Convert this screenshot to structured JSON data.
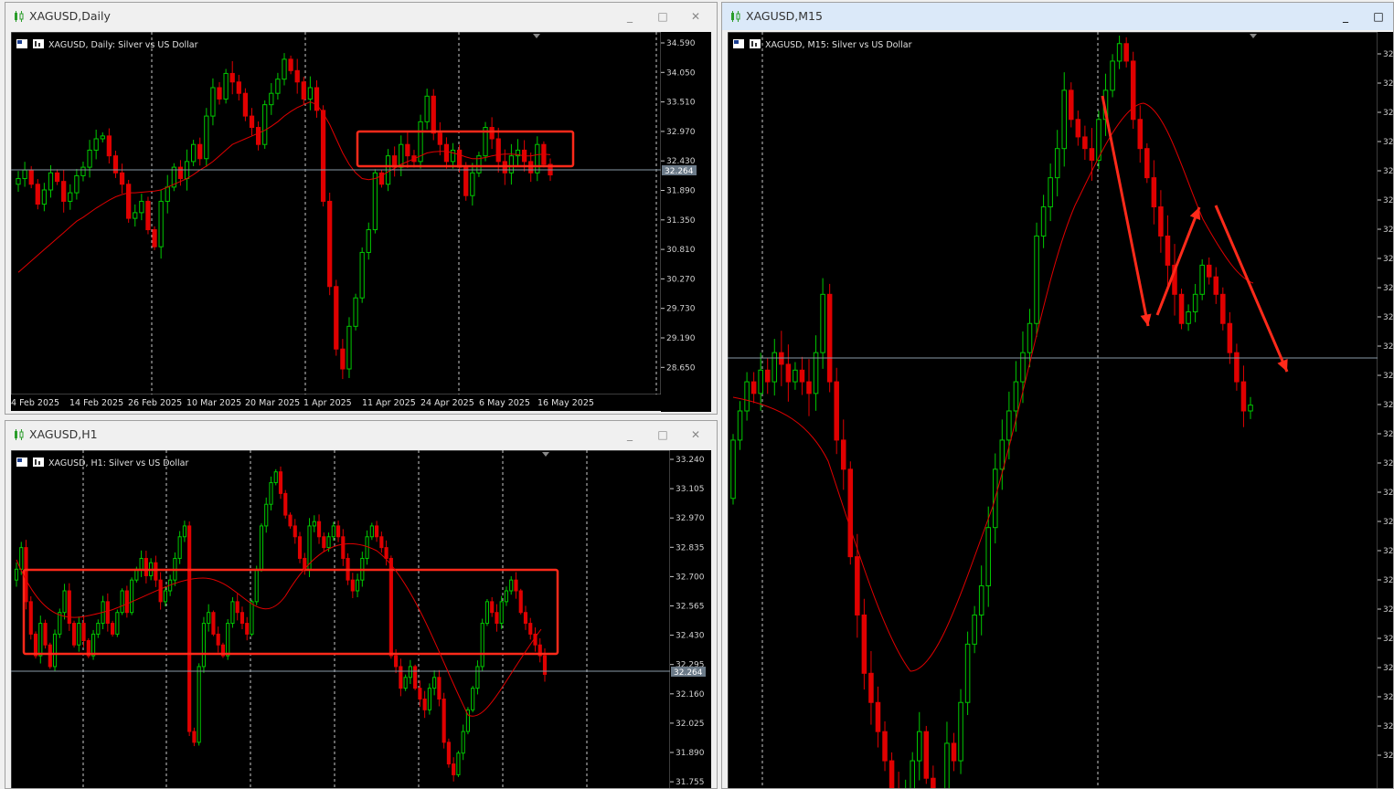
{
  "windows": {
    "daily": {
      "title": "XAGUSD,Daily",
      "header": "XAGUSD, Daily:  Silver vs US Dollar",
      "price_ticks": [
        "34.590",
        "34.050",
        "33.510",
        "32.970",
        "32.430",
        "31.890",
        "31.350",
        "30.810",
        "30.270",
        "29.730",
        "29.190",
        "28.650"
      ],
      "date_ticks": [
        "4 Feb 2025",
        "14 Feb 2025",
        "26 Feb 2025",
        "10 Mar 2025",
        "20 Mar 2025",
        "1 Apr 2025",
        "11 Apr 2025",
        "24 Apr 2025",
        "6 May 2025",
        "16 May 2025"
      ],
      "current_price": "32.264"
    },
    "h1": {
      "title": "XAGUSD,H1",
      "header": "XAGUSD, H1:  Silver vs US Dollar",
      "price_ticks": [
        "33.240",
        "33.105",
        "32.970",
        "32.835",
        "32.700",
        "32.565",
        "32.430",
        "32.295",
        "32.160",
        "32.025",
        "31.890",
        "31.755"
      ],
      "current_price": "32.264"
    },
    "m15": {
      "title": "XAGUSD,M15",
      "header": "XAGUSD, M15:  Silver vs US Dollar",
      "price_ticks": [
        "32",
        "32",
        "32",
        "32",
        "32",
        "32",
        "32",
        "32",
        "32",
        "32",
        "32",
        "32",
        "32",
        "32",
        "32",
        "32",
        "32",
        "32",
        "32",
        "32",
        "32",
        "32",
        "32",
        "32",
        "32"
      ],
      "current_price": "32"
    }
  },
  "colors": {
    "bull": "#00c800",
    "bear": "#e00000",
    "ma": "#e00000",
    "grid": "#c8c8c8",
    "annotation": "#ff2a1a",
    "price_line": "#8a9aa8"
  },
  "chart_data": [
    {
      "type": "candlestick",
      "symbol": "XAGUSD",
      "timeframe": "Daily",
      "ylim": [
        28.4,
        34.78
      ],
      "y_ticks": [
        34.59,
        34.05,
        33.51,
        32.97,
        32.43,
        31.89,
        31.35,
        30.81,
        30.27,
        29.73,
        29.19,
        28.65
      ],
      "x_tick_labels": [
        "4 Feb 2025",
        "14 Feb 2025",
        "26 Feb 2025",
        "10 Mar 2025",
        "20 Mar 2025",
        "1 Apr 2025",
        "11 Apr 2025",
        "24 Apr 2025",
        "6 May 2025",
        "16 May 2025"
      ],
      "current_price": 32.264,
      "closes": [
        32.2,
        32.35,
        32.1,
        31.75,
        32.0,
        32.3,
        32.15,
        31.8,
        31.95,
        32.25,
        32.4,
        32.7,
        32.9,
        32.95,
        32.6,
        32.3,
        32.1,
        31.5,
        31.6,
        31.8,
        31.3,
        31.0,
        31.8,
        32.05,
        32.4,
        32.2,
        32.5,
        32.8,
        32.55,
        33.3,
        33.8,
        33.6,
        34.05,
        33.9,
        33.7,
        33.3,
        33.1,
        32.8,
        33.5,
        33.7,
        33.95,
        34.3,
        34.1,
        33.9,
        33.6,
        33.8,
        33.4,
        31.8,
        30.3,
        29.2,
        28.85,
        29.6,
        30.1,
        30.9,
        31.3,
        32.3,
        32.1,
        32.6,
        32.4,
        32.8,
        32.6,
        32.5,
        33.2,
        33.65,
        33.0,
        32.8,
        32.5,
        32.7,
        32.4,
        31.9,
        32.3,
        32.6,
        33.1,
        32.9,
        32.5,
        32.3,
        32.6,
        32.7,
        32.5,
        32.3,
        32.8,
        32.45,
        32.264
      ],
      "ma": [
        30.55,
        30.65,
        30.75,
        30.85,
        30.95,
        31.05,
        31.15,
        31.25,
        31.35,
        31.45,
        31.52,
        31.6,
        31.68,
        31.75,
        31.82,
        31.88,
        31.92,
        31.95,
        31.95,
        31.96,
        31.97,
        31.98,
        32.0,
        32.05,
        32.1,
        32.15,
        32.2,
        32.27,
        32.35,
        32.42,
        32.5,
        32.6,
        32.7,
        32.8,
        32.85,
        32.9,
        32.95,
        33.0,
        33.05,
        33.12,
        33.2,
        33.3,
        33.38,
        33.45,
        33.5,
        33.55,
        33.5,
        33.35,
        33.15,
        32.9,
        32.65,
        32.45,
        32.3,
        32.2,
        32.18,
        32.2,
        32.25,
        32.32,
        32.38,
        32.45,
        32.5,
        32.55,
        32.6,
        32.65,
        32.67,
        32.68,
        32.68,
        32.65,
        32.62,
        32.58,
        32.55,
        32.55,
        32.57,
        32.6,
        32.62,
        32.63,
        32.63,
        32.62,
        32.6,
        32.6,
        32.62,
        32.63,
        32.62
      ],
      "annotation": {
        "shape": "rectangle",
        "price_range": [
          32.4,
          32.97
        ]
      }
    },
    {
      "type": "candlestick",
      "symbol": "XAGUSD",
      "timeframe": "H1",
      "ylim": [
        31.73,
        33.3
      ],
      "y_ticks": [
        33.24,
        33.105,
        32.97,
        32.835,
        32.7,
        32.565,
        32.43,
        32.295,
        32.16,
        32.025,
        31.89,
        31.755
      ],
      "current_price": 32.264,
      "closes": [
        32.75,
        32.85,
        32.6,
        32.45,
        32.35,
        32.5,
        32.4,
        32.3,
        32.45,
        32.55,
        32.65,
        32.5,
        32.4,
        32.5,
        32.42,
        32.35,
        32.45,
        32.5,
        32.6,
        32.5,
        32.45,
        32.55,
        32.65,
        32.55,
        32.7,
        32.75,
        32.8,
        32.72,
        32.78,
        32.7,
        32.6,
        32.65,
        32.7,
        32.8,
        32.9,
        32.95,
        32.0,
        31.95,
        32.3,
        32.5,
        32.55,
        32.45,
        32.4,
        32.35,
        32.5,
        32.6,
        32.55,
        32.5,
        32.45,
        32.6,
        32.75,
        32.95,
        33.05,
        33.15,
        33.2,
        33.1,
        33.0,
        32.95,
        32.9,
        32.8,
        32.75,
        32.95,
        32.97,
        32.9,
        32.85,
        32.9,
        32.95,
        32.9,
        32.8,
        32.7,
        32.65,
        32.7,
        32.8,
        32.9,
        32.95,
        32.9,
        32.85,
        32.8,
        32.35,
        32.3,
        32.2,
        32.25,
        32.3,
        32.2,
        32.15,
        32.1,
        32.2,
        32.25,
        32.15,
        31.95,
        31.85,
        31.8,
        31.9,
        32.0,
        32.1,
        32.2,
        32.3,
        32.5,
        32.6,
        32.55,
        32.5,
        32.6,
        32.65,
        32.7,
        32.65,
        32.55,
        32.5,
        32.45,
        32.4,
        32.35,
        32.264
      ],
      "annotation": {
        "shape": "rectangle",
        "price_range": [
          32.35,
          32.75
        ]
      }
    },
    {
      "type": "candlestick",
      "symbol": "XAGUSD",
      "timeframe": "M15",
      "ylim": [
        31.6,
        32.9
      ],
      "closes": [
        32.2,
        32.25,
        32.3,
        32.28,
        32.32,
        32.3,
        32.35,
        32.33,
        32.3,
        32.32,
        32.3,
        32.28,
        32.35,
        32.45,
        32.3,
        32.2,
        32.15,
        32.0,
        31.9,
        31.8,
        31.75,
        31.7,
        31.65,
        31.6,
        31.55,
        31.6,
        31.65,
        31.7,
        31.62,
        31.55,
        31.58,
        31.68,
        31.65,
        31.75,
        31.85,
        31.9,
        31.95,
        32.05,
        32.15,
        32.2,
        32.25,
        32.3,
        32.35,
        32.4,
        32.55,
        32.6,
        32.65,
        32.7,
        32.8,
        32.75,
        32.72,
        32.7,
        32.68,
        32.75,
        32.8,
        32.85,
        32.88,
        32.85,
        32.75,
        32.7,
        32.65,
        32.6,
        32.55,
        32.5,
        32.45,
        32.4,
        32.42,
        32.45,
        32.5,
        32.48,
        32.45,
        32.4,
        32.35,
        32.3,
        32.25,
        32.26
      ],
      "annotations": [
        {
          "shape": "arrow",
          "direction": "down"
        },
        {
          "shape": "arrow",
          "direction": "up"
        },
        {
          "shape": "arrow",
          "direction": "down"
        }
      ]
    }
  ]
}
